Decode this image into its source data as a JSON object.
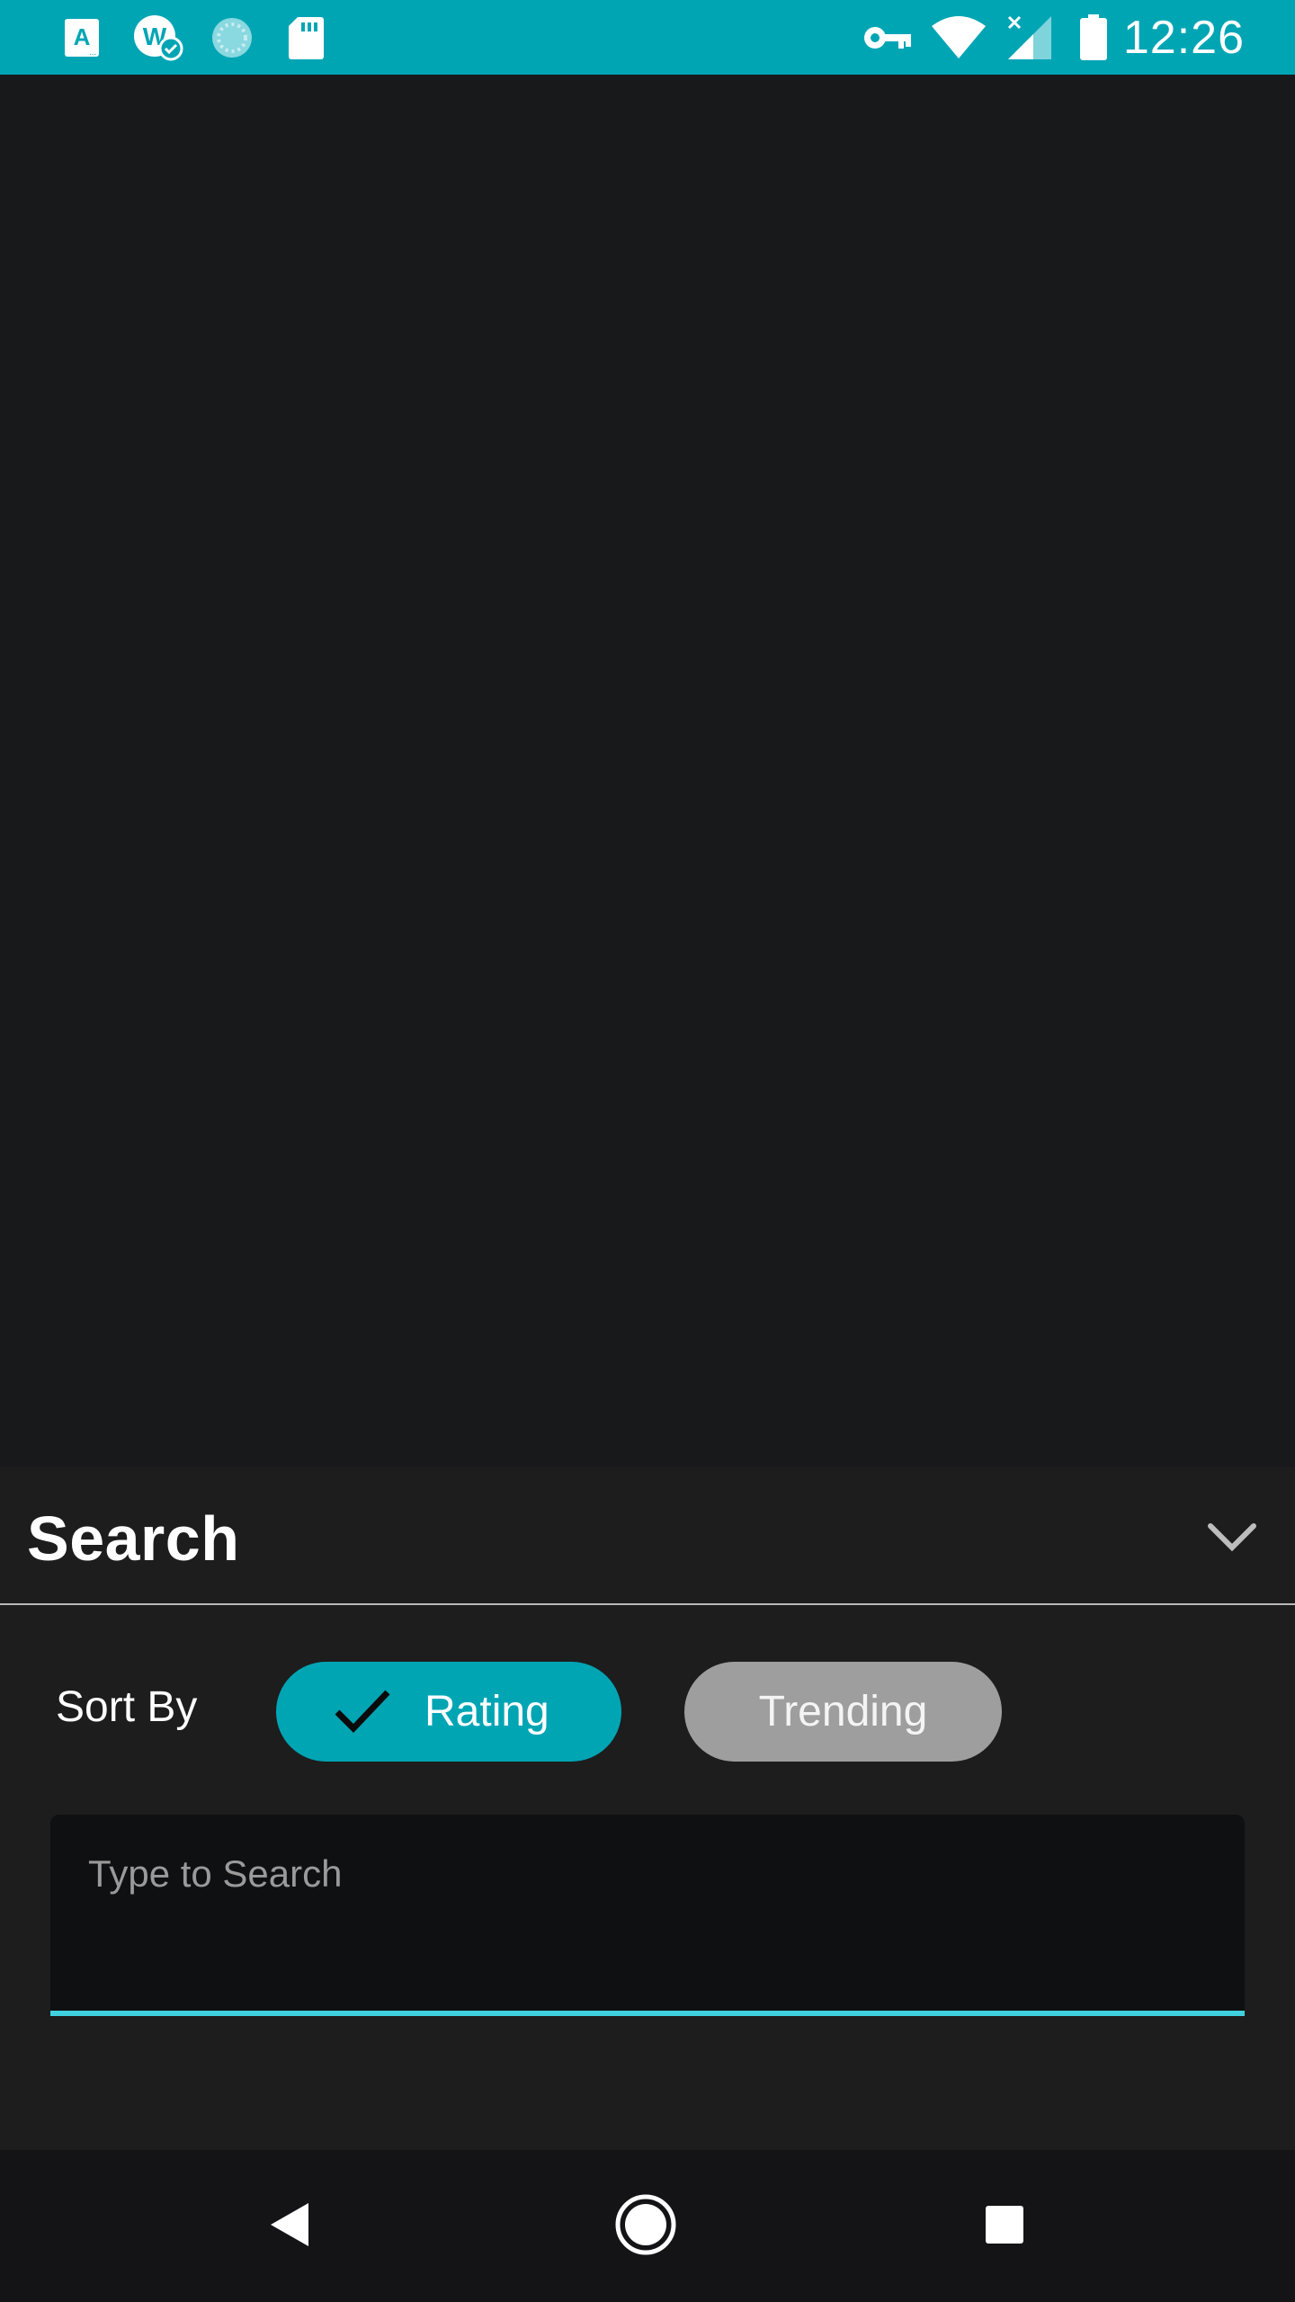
{
  "status_bar": {
    "time": "12:26",
    "color": "#00a5b4",
    "icons": [
      "text-a-icon",
      "web-check-icon",
      "loading-circle-icon",
      "sd-card-icon",
      "vpn-key-icon",
      "wifi-icon",
      "cellular-no-signal-icon",
      "battery-icon"
    ]
  },
  "sheet": {
    "title": "Search",
    "sort_label": "Sort By",
    "chips": [
      {
        "label": "Rating",
        "selected": true
      },
      {
        "label": "Trending",
        "selected": false
      }
    ],
    "search": {
      "placeholder": "Type to Search",
      "value": ""
    }
  },
  "colors": {
    "accent": "#00a5b4",
    "underline": "#3fd2de",
    "chip_unselected": "#9e9e9e",
    "background": "#18191b"
  },
  "nav_bar": {
    "buttons": [
      "back-icon",
      "home-icon",
      "recents-icon"
    ]
  }
}
